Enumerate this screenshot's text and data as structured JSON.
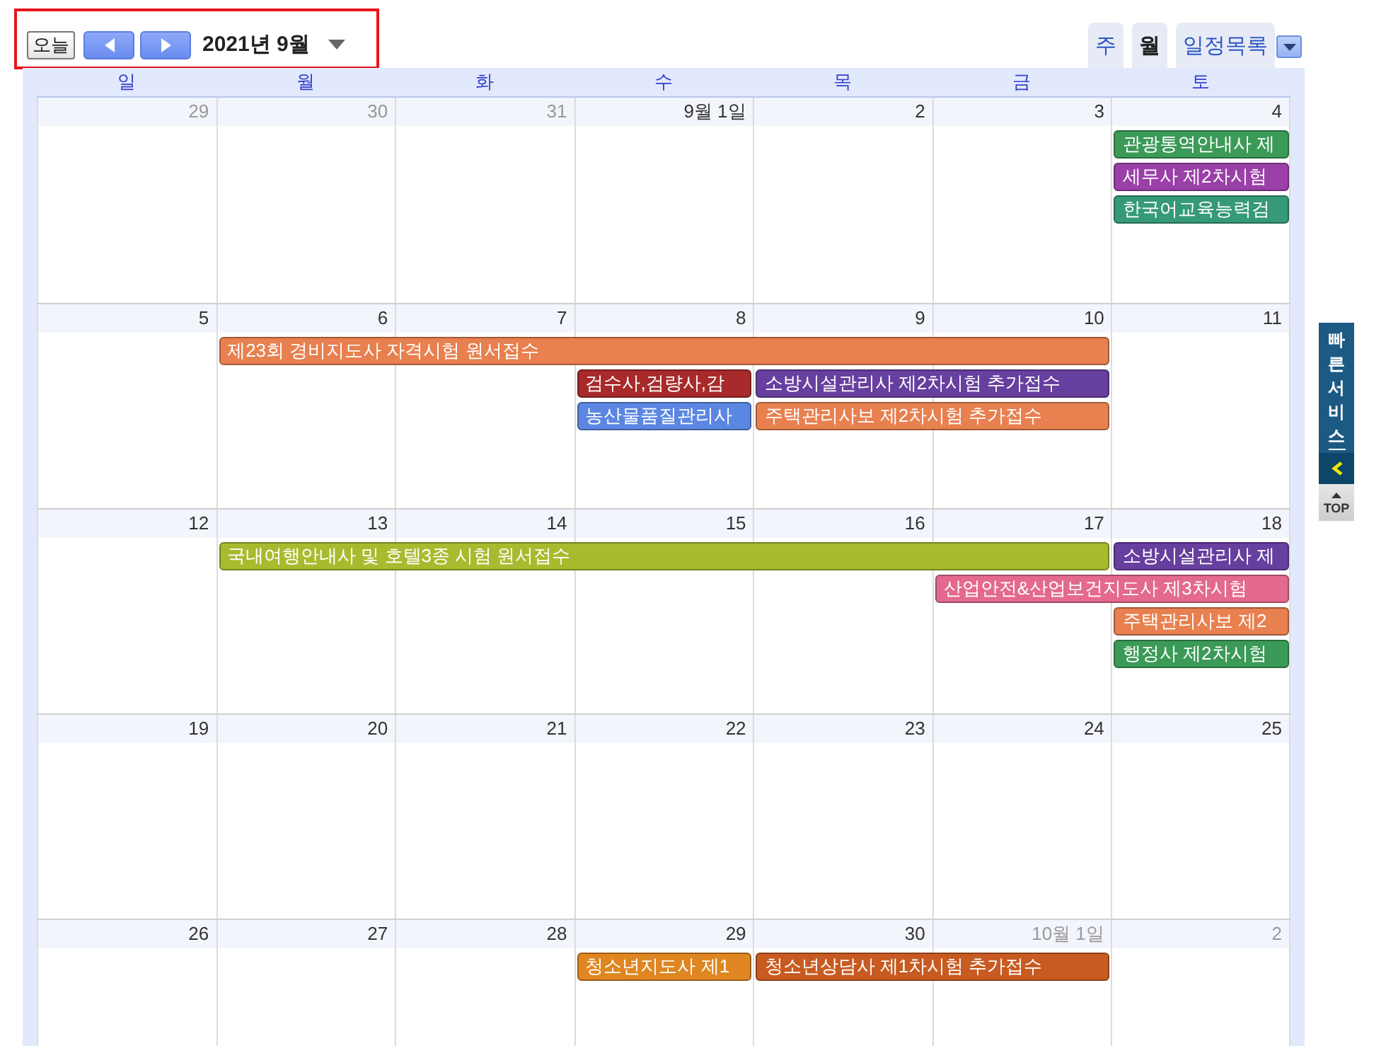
{
  "toolbar": {
    "today_button": "오늘",
    "period_title": "2021년 9월"
  },
  "view_tabs": [
    {
      "label": "주",
      "selected": false
    },
    {
      "label": "월",
      "selected": true
    },
    {
      "label": "일정목록",
      "selected": false
    }
  ],
  "calendar": {
    "weekdays": [
      "일",
      "월",
      "화",
      "수",
      "목",
      "금",
      "토"
    ],
    "weeks": [
      {
        "days": [
          {
            "label": "29",
            "other_month": true
          },
          {
            "label": "30",
            "other_month": true
          },
          {
            "label": "31",
            "other_month": true
          },
          {
            "label": "9월 1일",
            "other_month": false
          },
          {
            "label": "2",
            "other_month": false
          },
          {
            "label": "3",
            "other_month": false
          },
          {
            "label": "4",
            "other_month": false
          }
        ],
        "lanes": [
          [
            {
              "kind": "empty"
            },
            {
              "kind": "empty"
            },
            {
              "kind": "empty"
            },
            {
              "kind": "empty"
            },
            {
              "kind": "empty"
            },
            {
              "kind": "empty"
            },
            {
              "kind": "event",
              "title": "관광통역안내사 제",
              "color": "#3b9a57"
            }
          ],
          [
            {
              "kind": "empty"
            },
            {
              "kind": "empty"
            },
            {
              "kind": "empty"
            },
            {
              "kind": "empty"
            },
            {
              "kind": "empty"
            },
            {
              "kind": "empty"
            },
            {
              "kind": "event",
              "title": "세무사 제2차시험",
              "color": "#9a40a8"
            }
          ],
          [
            {
              "kind": "empty"
            },
            {
              "kind": "empty"
            },
            {
              "kind": "empty"
            },
            {
              "kind": "empty"
            },
            {
              "kind": "empty"
            },
            {
              "kind": "empty"
            },
            {
              "kind": "event",
              "title": "한국어교육능력검",
              "color": "#35997a"
            }
          ]
        ]
      },
      {
        "days": [
          {
            "label": "5",
            "other_month": false
          },
          {
            "label": "6",
            "other_month": false
          },
          {
            "label": "7",
            "other_month": false
          },
          {
            "label": "8",
            "other_month": false
          },
          {
            "label": "9",
            "other_month": false
          },
          {
            "label": "10",
            "other_month": false
          },
          {
            "label": "11",
            "other_month": false
          }
        ],
        "lanes": [
          [
            {
              "kind": "empty"
            },
            {
              "kind": "event",
              "title": "제23회 경비지도사 자격시험 원서접수",
              "color": "#e8804f"
            },
            {
              "kind": "continued"
            },
            {
              "kind": "continued"
            },
            {
              "kind": "continued"
            },
            {
              "kind": "continued"
            }
          ],
          [
            {
              "kind": "empty"
            },
            {
              "kind": "empty"
            },
            {
              "kind": "empty"
            },
            {
              "kind": "event",
              "title": "검수사,검량사,감",
              "color": "#a82a2a"
            },
            {
              "kind": "event",
              "title": "소방시설관리사 제2차시험 추가접수",
              "color": "#673f9f"
            },
            {
              "kind": "continued"
            }
          ],
          [
            {
              "kind": "empty"
            },
            {
              "kind": "empty"
            },
            {
              "kind": "empty"
            },
            {
              "kind": "event",
              "title": "농산물품질관리사",
              "color": "#5b87e2"
            },
            {
              "kind": "event",
              "title": "주택관리사보 제2차시험 추가접수",
              "color": "#e8804f"
            },
            {
              "kind": "continued"
            }
          ]
        ]
      },
      {
        "days": [
          {
            "label": "12",
            "other_month": false
          },
          {
            "label": "13",
            "other_month": false
          },
          {
            "label": "14",
            "other_month": false
          },
          {
            "label": "15",
            "other_month": false
          },
          {
            "label": "16",
            "other_month": false
          },
          {
            "label": "17",
            "other_month": false
          },
          {
            "label": "18",
            "other_month": false
          }
        ],
        "lanes": [
          [
            {
              "kind": "empty"
            },
            {
              "kind": "event",
              "title": "국내여행안내사 및 호텔3종 시험 원서접수",
              "color": "#a8bb2f"
            },
            {
              "kind": "continued"
            },
            {
              "kind": "continued"
            },
            {
              "kind": "continued"
            },
            {
              "kind": "continued"
            },
            {
              "kind": "event",
              "title": "소방시설관리사 제",
              "color": "#673f9f"
            }
          ],
          [
            {
              "kind": "empty"
            },
            {
              "kind": "empty"
            },
            {
              "kind": "empty"
            },
            {
              "kind": "empty"
            },
            {
              "kind": "empty"
            },
            {
              "kind": "event",
              "title": "산업안전&산업보건지도사 제3차시험",
              "color": "#e4698f"
            },
            {
              "kind": "continued"
            }
          ],
          [
            {
              "kind": "empty"
            },
            {
              "kind": "empty"
            },
            {
              "kind": "empty"
            },
            {
              "kind": "empty"
            },
            {
              "kind": "empty"
            },
            {
              "kind": "empty"
            },
            {
              "kind": "event",
              "title": "주택관리사보 제2",
              "color": "#e8804f"
            }
          ],
          [
            {
              "kind": "empty"
            },
            {
              "kind": "empty"
            },
            {
              "kind": "empty"
            },
            {
              "kind": "empty"
            },
            {
              "kind": "empty"
            },
            {
              "kind": "empty"
            },
            {
              "kind": "event",
              "title": "행정사 제2차시험",
              "color": "#3b9a57"
            }
          ]
        ]
      },
      {
        "days": [
          {
            "label": "19",
            "other_month": false
          },
          {
            "label": "20",
            "other_month": false
          },
          {
            "label": "21",
            "other_month": false
          },
          {
            "label": "22",
            "other_month": false
          },
          {
            "label": "23",
            "other_month": false
          },
          {
            "label": "24",
            "other_month": false
          },
          {
            "label": "25",
            "other_month": false
          }
        ]
      },
      {
        "days": [
          {
            "label": "26",
            "other_month": false
          },
          {
            "label": "27",
            "other_month": false
          },
          {
            "label": "28",
            "other_month": false
          },
          {
            "label": "29",
            "other_month": false
          },
          {
            "label": "30",
            "other_month": false
          },
          {
            "label": "10월 1일",
            "other_month": true
          },
          {
            "label": "2",
            "other_month": true
          }
        ],
        "lanes": [
          [
            {
              "kind": "empty"
            },
            {
              "kind": "empty"
            },
            {
              "kind": "empty"
            },
            {
              "kind": "event",
              "title": "청소년지도사 제1",
              "color": "#df8621"
            },
            {
              "kind": "event",
              "title": "청소년상담사 제1차시험 추가접수",
              "color": "#c85b21"
            },
            {
              "kind": "continued"
            }
          ]
        ]
      }
    ]
  },
  "quick_service": {
    "label": "빠른서비스",
    "top_button": "TOP"
  }
}
